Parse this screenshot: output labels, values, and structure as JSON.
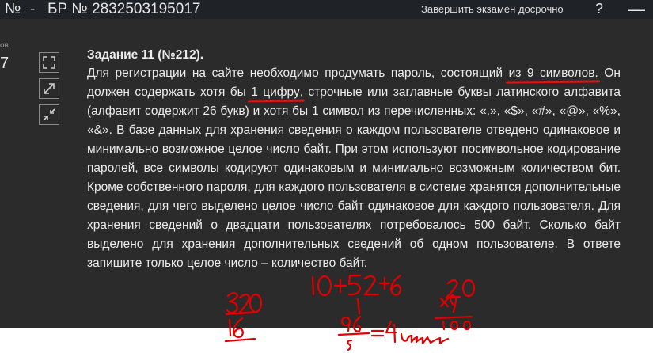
{
  "topbar": {
    "number_label": "№",
    "dash": "-",
    "title": "БР № 2832503195017",
    "finish_button": "Завершить экзамен досрочно",
    "help": "?",
    "close": "—"
  },
  "left_strip": {
    "label": "ов",
    "value": "7"
  },
  "task": {
    "title": "Задание 11 (№212).",
    "text_parts": [
      "Для регистрации на сайте необходимо продумать пароль, состоящий ",
      "из 9 символов",
      ". Он должен содержать хотя бы ",
      "1 цифру",
      ", строчные или заглавные буквы латинского алфавита (алфавит содержит 26 букв) и хотя бы 1 символ из перечисленных: «.», «$», «#», «@», «%», «&». В базе данных для хранения сведения о каждом пользователе отведено одинаковое и минимально возможное целое число байт. При этом используют посимвольное кодирование паролей, все символы кодируют одинаковым и минимально возможным количеством бит. Кроме собственного пароля, для каждого пользователя в системе хранятся дополнительные сведения, для чего выделено целое число байт одинаковое для каждого пользователя. Для хранения сведений о двадцати пользователях потребовалось 500 байт. Сколько байт выделено для хранения дополнительных сведений об одном пользователе. В ответе запишите только целое число – количество байт."
    ]
  },
  "tools": [
    "shrink-icon",
    "expand-icon",
    "collapse-icon"
  ],
  "handwriting_color": "#e00000"
}
